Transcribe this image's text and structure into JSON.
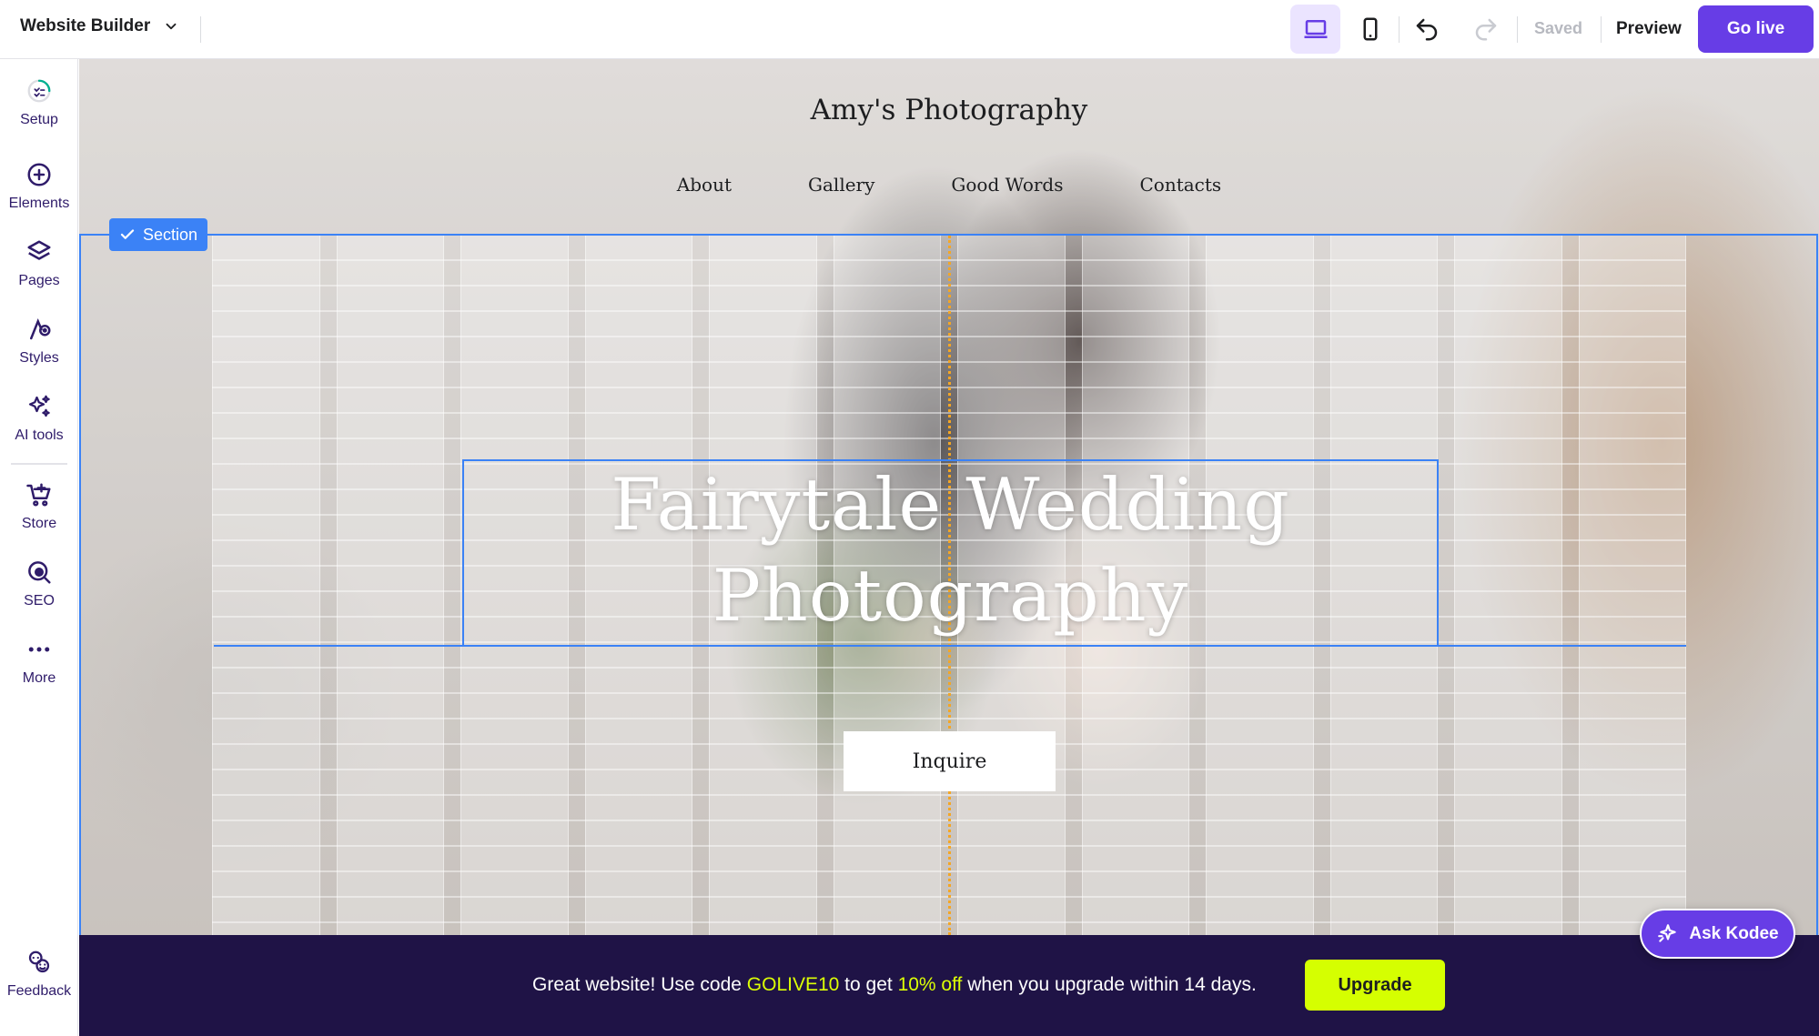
{
  "topbar": {
    "app_name": "Website Builder",
    "saved_label": "Saved",
    "preview_label": "Preview",
    "golive_label": "Go live"
  },
  "sidebar": {
    "items": [
      {
        "label": "Setup",
        "icon": "setup-progress-icon"
      },
      {
        "label": "Elements",
        "icon": "plus-circle-icon"
      },
      {
        "label": "Pages",
        "icon": "layers-icon"
      },
      {
        "label": "Styles",
        "icon": "palette-icon"
      },
      {
        "label": "AI tools",
        "icon": "sparkles-icon"
      },
      {
        "label": "Store",
        "icon": "cart-icon"
      },
      {
        "label": "SEO",
        "icon": "seo-search-icon"
      },
      {
        "label": "More",
        "icon": "more-dots-icon"
      }
    ],
    "feedback_label": "Feedback"
  },
  "site": {
    "title": "Amy's Photography",
    "nav": [
      "About",
      "Gallery",
      "Good Words",
      "Contacts"
    ],
    "heading_line1": "Fairytale Wedding",
    "heading_line2": "Photography",
    "cta_label": "Inquire"
  },
  "editor": {
    "section_tag": "Section"
  },
  "promo": {
    "text_1": "Great website! Use code ",
    "code": "GOLIVE10",
    "text_2": " to get ",
    "discount": "10% off",
    "text_3": " when you upgrade within 14 days.",
    "upgrade_label": "Upgrade"
  },
  "assistant": {
    "label": "Ask Kodee"
  },
  "colors": {
    "brand": "#673de6",
    "selection": "#3b82f6",
    "promo_bg": "#1f1346",
    "promo_highlight": "#dcff05"
  }
}
